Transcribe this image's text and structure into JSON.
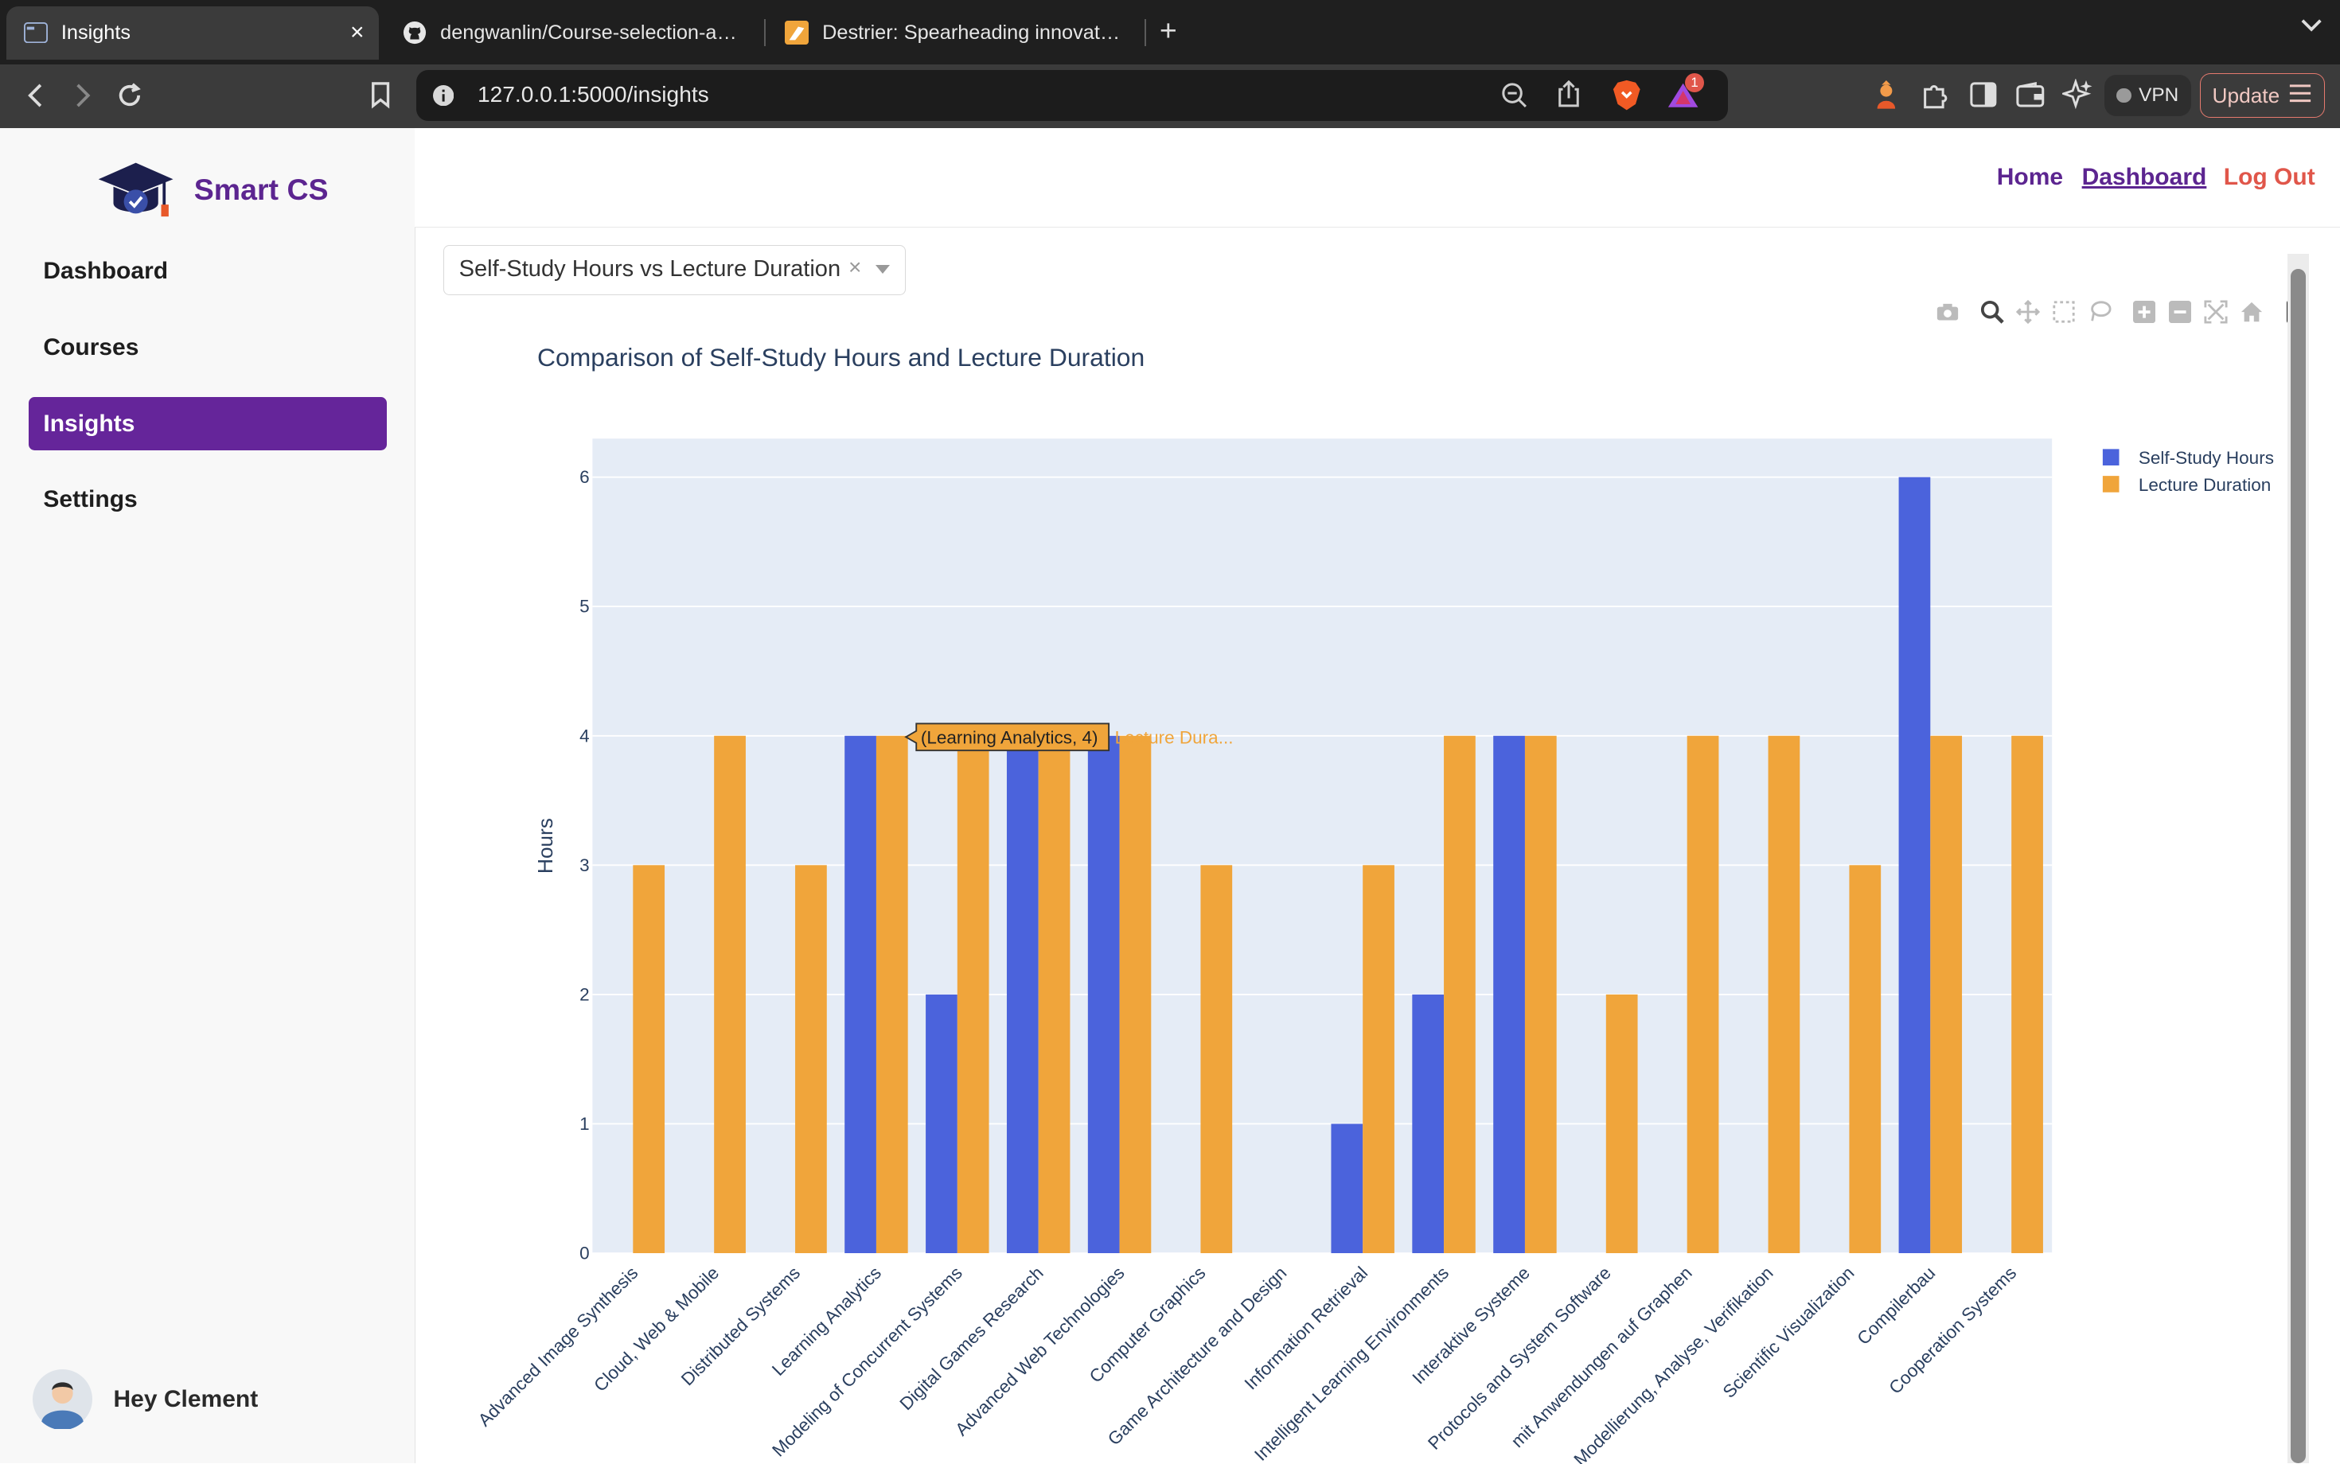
{
  "browser": {
    "tabs": [
      {
        "title": "Insights",
        "active": true
      },
      {
        "title": "dengwanlin/Course-selection-adv",
        "active": false
      },
      {
        "title": "Destrier: Spearheading innovation",
        "active": false
      }
    ],
    "new_tab": "+",
    "close": "×",
    "url": "127.0.0.1:5000/insights",
    "vpn_label": "VPN",
    "update_label": "Update",
    "notification_count": "1"
  },
  "app": {
    "brand": "Smart CS",
    "brand_color": "#5c2590",
    "sidebar": {
      "items": [
        {
          "label": "Dashboard",
          "active": false
        },
        {
          "label": "Courses",
          "active": false
        },
        {
          "label": "Insights",
          "active": true
        },
        {
          "label": "Settings",
          "active": false
        }
      ],
      "user_greeting": "Hey Clement"
    },
    "header": {
      "links": [
        {
          "label": "Home",
          "color": "#5c2590"
        },
        {
          "label": "Dashboard",
          "color": "#5c2590"
        },
        {
          "label": "Log Out",
          "color": "#e0564a"
        }
      ]
    },
    "select": {
      "value": "Self-Study Hours vs Lecture Duration",
      "clear": "×"
    },
    "tooltip": {
      "text": "(Learning Analytics, 4)",
      "series_name": "Lecture Dura..."
    }
  },
  "chart_data": {
    "type": "bar",
    "title": "Comparison of Self-Study Hours and Lecture Duration",
    "xlabel": "",
    "ylabel": "Hours",
    "ylim": [
      0,
      6.3
    ],
    "yticks": [
      0,
      1,
      2,
      3,
      4,
      5,
      6
    ],
    "grid": true,
    "legend_position": "top-right",
    "categories": [
      "Advanced Image Synthesis",
      "Cloud, Web & Mobile",
      "Distributed Systems",
      "Learning Analytics",
      "Modeling of Concurrent Systems",
      "Digital Games Research",
      "Advanced Web Technologies",
      "Computer Graphics",
      "Game Architecture and Design",
      "Information Retrieval",
      "Intelligent Learning Environments",
      "Interaktive Systeme",
      "Protocols and System Software",
      "mit Anwendungen auf Graphen",
      "Modellierung, Analyse, Verifikation",
      "Scientific Visualization",
      "Compilerbau",
      "Cooperation Systems"
    ],
    "series": [
      {
        "name": "Self-Study Hours",
        "color": "#4b63dc",
        "values": [
          0,
          0,
          0,
          4,
          2,
          4,
          4,
          0,
          0,
          1,
          2,
          4,
          0,
          0,
          0,
          0,
          6,
          0
        ]
      },
      {
        "name": "Lecture Duration",
        "color": "#f0a53b",
        "values": [
          3,
          4,
          3,
          4,
          4,
          4,
          4,
          3,
          0,
          3,
          4,
          4,
          2,
          4,
          4,
          3,
          4,
          4
        ]
      }
    ]
  }
}
